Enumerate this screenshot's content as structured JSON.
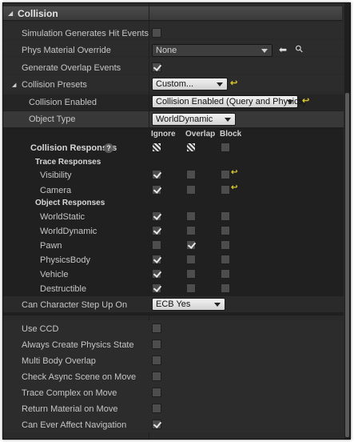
{
  "section": {
    "title": "Collision"
  },
  "rows": {
    "sim_hit": "Simulation Generates Hit Events",
    "phys_mat": "Phys Material Override",
    "phys_mat_value": "None",
    "overlap_events": "Generate Overlap Events",
    "presets": "Collision Presets",
    "presets_value": "Custom...",
    "enabled": "Collision Enabled",
    "enabled_value": "Collision Enabled (Query and Physics)",
    "object_type": "Object Type",
    "object_type_value": "WorldDynamic",
    "col_ignore": "Ignore",
    "col_overlap": "Overlap",
    "col_block": "Block",
    "responses": "Collision Responses",
    "trace_responses": "Trace Responses",
    "visibility": "Visibility",
    "camera": "Camera",
    "object_responses": "Object Responses",
    "world_static": "WorldStatic",
    "world_dynamic": "WorldDynamic",
    "pawn": "Pawn",
    "physics_body": "PhysicsBody",
    "vehicle": "Vehicle",
    "destructible": "Destructible",
    "step_up": "Can Character Step Up On",
    "step_up_value": "ECB Yes",
    "use_ccd": "Use CCD",
    "always_create": "Always Create Physics State",
    "multi_body": "Multi Body Overlap",
    "async_scene": "Check Async Scene on Move",
    "trace_complex": "Trace Complex on Move",
    "return_material": "Return Material on Move",
    "affect_nav": "Can Ever Affect Navigation"
  },
  "icons": {
    "header_arrow": "expanded-arrow-icon",
    "browse": "arrow-left-icon",
    "search": "search-icon",
    "reset": "reset-to-default-icon",
    "help": "help-icon"
  },
  "glyphs": {
    "arrow": "◢",
    "browse": "⬅",
    "search": "⚲",
    "reset": "↩",
    "help": "?"
  },
  "colors": {
    "panel": "#2a2a2a",
    "subpanel": "#202020",
    "reset_accent": "#d7c52a"
  }
}
